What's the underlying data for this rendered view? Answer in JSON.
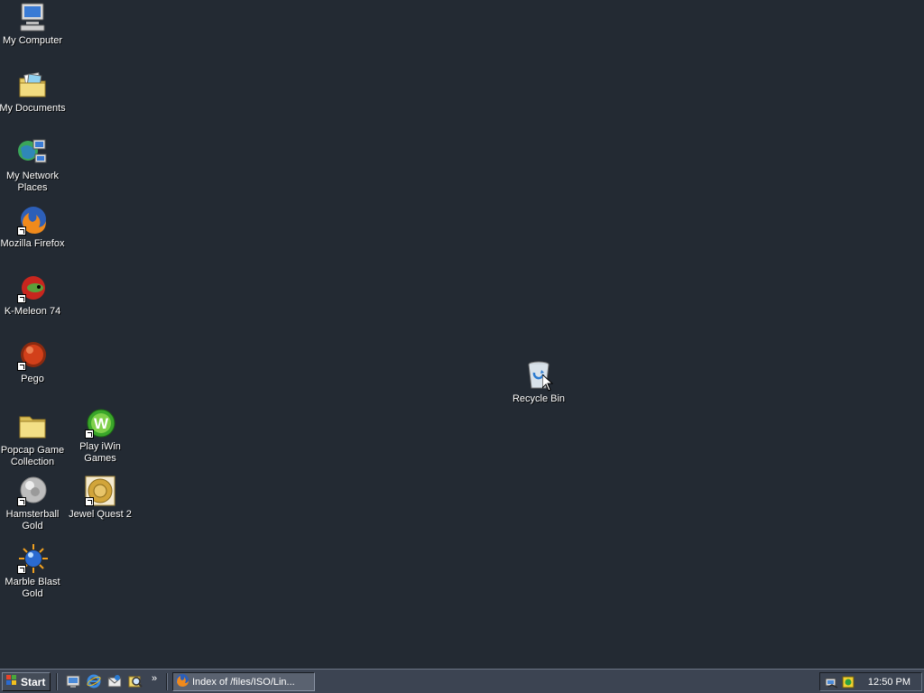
{
  "desktop": {
    "icons": [
      {
        "label": "My Computer"
      },
      {
        "label": "My Documents"
      },
      {
        "label": "My Network Places"
      },
      {
        "label": "Mozilla Firefox"
      },
      {
        "label": "K-Meleon 74"
      },
      {
        "label": "Pego"
      },
      {
        "label": "Popcap Game Collection"
      },
      {
        "label": "Play iWin Games"
      },
      {
        "label": "Hamsterball Gold"
      },
      {
        "label": "Jewel Quest 2"
      },
      {
        "label": "Marble Blast Gold"
      },
      {
        "label": "Recycle Bin"
      }
    ],
    "background_color": "#232a33"
  },
  "taskbar": {
    "start_label": "Start",
    "tasks": [
      {
        "label": "Index of /files/ISO/Lin...",
        "icon": "firefox-icon"
      }
    ],
    "quick_launch": [
      "show-desktop-icon",
      "internet-explorer-icon",
      "outlook-express-icon",
      "search-icon"
    ],
    "chevron": "»",
    "clock": "12:50 PM"
  }
}
